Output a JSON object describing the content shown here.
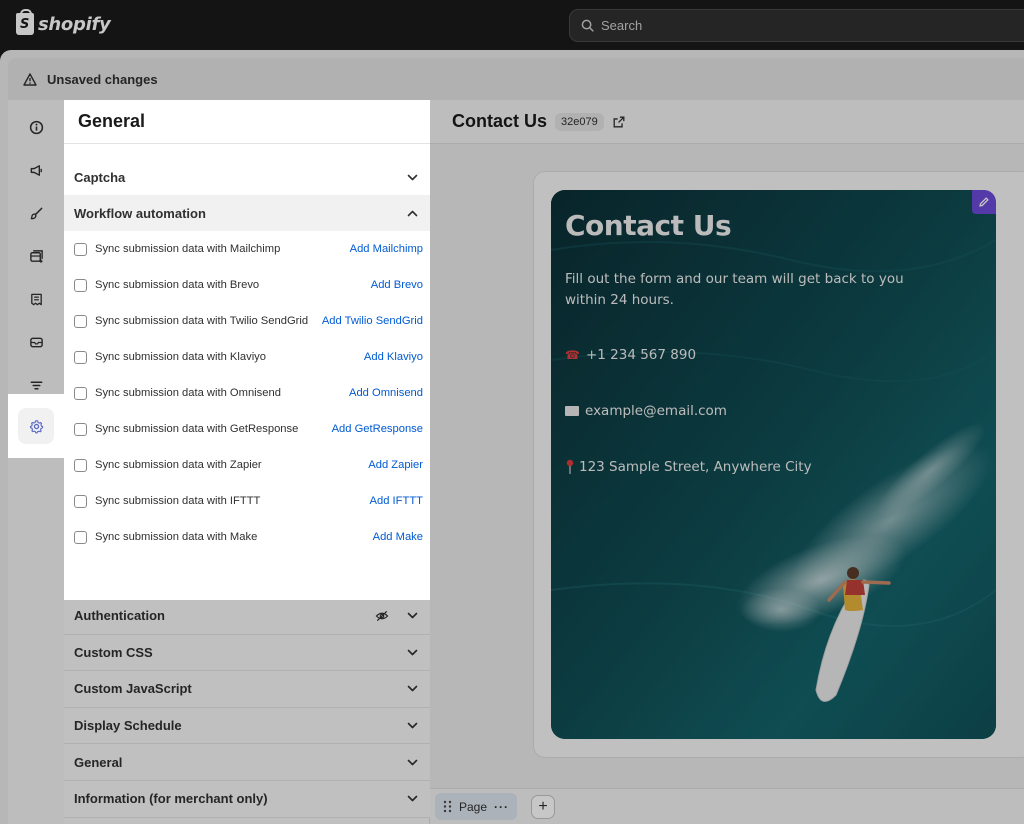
{
  "topbar": {
    "brand": "shopify",
    "search_placeholder": "Search"
  },
  "banner": {
    "text": "Unsaved changes"
  },
  "rail": {
    "icons": [
      "info-icon",
      "megaphone-icon",
      "brush-icon",
      "layout-icon",
      "receipt-icon",
      "mail-icon",
      "filter-icon",
      "gear-icon"
    ],
    "active": "gear-icon"
  },
  "settings": {
    "title": "General",
    "captcha": "Captcha",
    "workflow": {
      "label": "Workflow automation",
      "items": [
        {
          "label": "Sync submission data with Mailchimp",
          "action": "Add Mailchimp"
        },
        {
          "label": "Sync submission data with Brevo",
          "action": "Add Brevo"
        },
        {
          "label": "Sync submission data with Twilio SendGrid",
          "action": "Add Twilio SendGrid"
        },
        {
          "label": "Sync submission data with Klaviyo",
          "action": "Add Klaviyo"
        },
        {
          "label": "Sync submission data with Omnisend",
          "action": "Add Omnisend"
        },
        {
          "label": "Sync submission data with GetResponse",
          "action": "Add GetResponse"
        },
        {
          "label": "Sync submission data with Zapier",
          "action": "Add Zapier"
        },
        {
          "label": "Sync submission data with IFTTT",
          "action": "Add IFTTT"
        },
        {
          "label": "Sync submission data with Make",
          "action": "Add Make"
        }
      ]
    },
    "sections": [
      "Authentication",
      "Custom CSS",
      "Custom JavaScript",
      "Display Schedule",
      "General",
      "Information (for merchant only)"
    ]
  },
  "preview": {
    "title": "Contact Us",
    "badge": "32e079",
    "hero": {
      "heading": "Contact Us",
      "description": "Fill out the form and our team will get back to you within 24 hours.",
      "phone": "+1 234 567 890",
      "email": "example@email.com",
      "address": "123 Sample Street, Anywhere City"
    }
  },
  "bottom": {
    "page_label": "Page"
  },
  "colors": {
    "accent": "#005bd3",
    "edit_button": "#6c4bd8",
    "topbar": "#1a1a1a"
  }
}
